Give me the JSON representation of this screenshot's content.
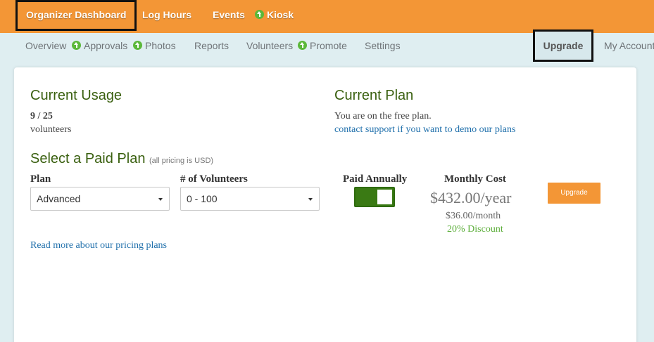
{
  "topnav": {
    "organizer_dashboard": "Organizer Dashboard",
    "log_hours": "Log Hours",
    "events": "Events",
    "kiosk": "Kiosk"
  },
  "subnav": {
    "overview": "Overview",
    "approvals": "Approvals",
    "photos": "Photos",
    "reports": "Reports",
    "volunteers": "Volunteers",
    "promote": "Promote",
    "settings": "Settings",
    "upgrade": "Upgrade",
    "my_account": "My Account"
  },
  "usage": {
    "title": "Current Usage",
    "count": "9 / 25",
    "unit": "volunteers"
  },
  "plan": {
    "title": "Current Plan",
    "status": "You are on the free plan.",
    "support_link": "contact support if you want to demo our plans"
  },
  "select_plan": {
    "title": "Select a Paid Plan",
    "note": "(all pricing is USD)",
    "plan_label": "Plan",
    "plan_value": "Advanced",
    "volunteers_label": "# of Volunteers",
    "volunteers_value": "0 - 100",
    "paid_annually_label": "Paid Annually",
    "paid_annually_on": true,
    "monthly_cost_label": "Monthly Cost",
    "yearly_price": "$432.00/year",
    "monthly_price": "$36.00/month",
    "discount": "20% Discount",
    "upgrade_button": "Upgrade",
    "read_more": "Read more about our pricing plans"
  },
  "colors": {
    "brand_orange": "#f39636",
    "header_green": "#3a6010",
    "toggle_green": "#3a7a14",
    "link_blue": "#1f6fab",
    "discount_green": "#5cae3a"
  },
  "icons": {
    "approve": "green-up-arrow-icon"
  }
}
